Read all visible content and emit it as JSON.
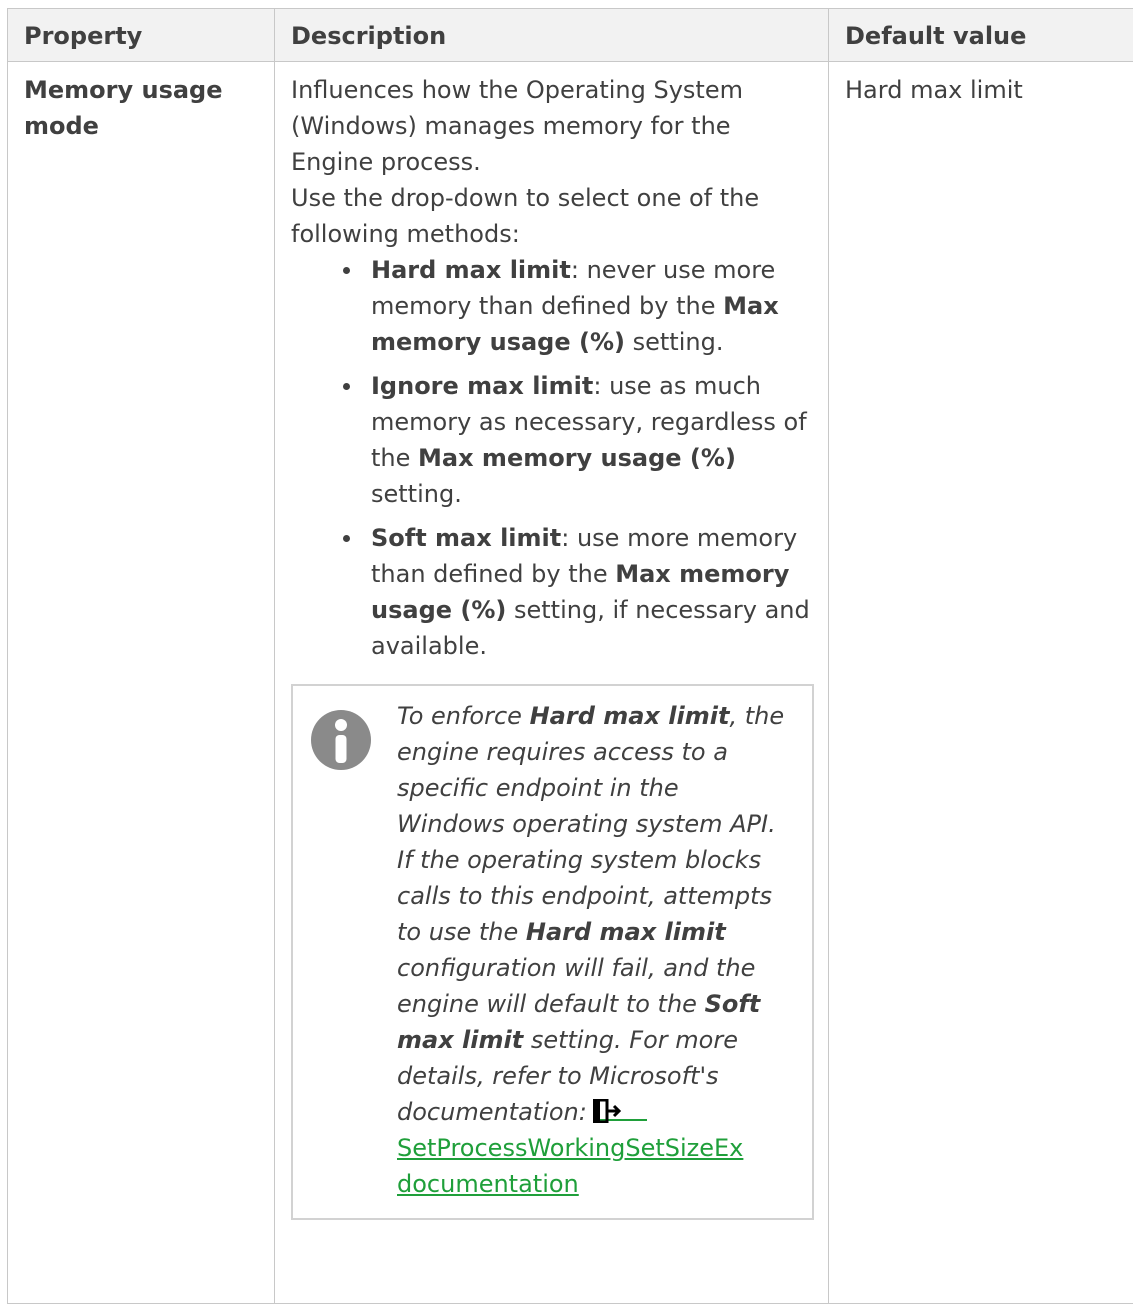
{
  "table": {
    "headers": {
      "property": "Property",
      "description": "Description",
      "default": "Default value"
    },
    "row": {
      "property": "Memory usage mode",
      "desc_intro": "Influences how the Operating System (Windows) manages memory for the Engine process.",
      "desc_select": "Use the drop-down to select one of the following methods:",
      "methods": [
        {
          "name": "Hard max limit",
          "text_a": ": never use more memory than defined by the ",
          "ref": "Max memory usage (%)",
          "text_b": " setting."
        },
        {
          "name": "Ignore max limit",
          "text_a": ": use as much memory as necessary, regardless of the ",
          "ref": "Max memory usage (%)",
          "text_b": " setting."
        },
        {
          "name": "Soft max limit",
          "text_a": ": use more memory than defined by the ",
          "ref": "Max memory usage (%)",
          "text_b": " setting, if necessary and available."
        }
      ],
      "note": {
        "icon": "info-icon",
        "t1": "To enforce ",
        "b1": "Hard max limit",
        "t2": ", the engine requires access to a specific endpoint in the Windows operating system API. If the operating system blocks calls to this endpoint, attempts to use the ",
        "b2": "Hard max limit",
        "t3": " configuration will fail, and the engine will default to the ",
        "b3": "Soft max limit",
        "t4": " setting. For more details, refer to Microsoft's documentation:",
        "link_icon": "external-link-icon",
        "link_text": "SetProcessWorkingSetSizeEx documentation",
        "link_color": "#1f9f3a"
      },
      "default": "Hard max limit"
    }
  }
}
